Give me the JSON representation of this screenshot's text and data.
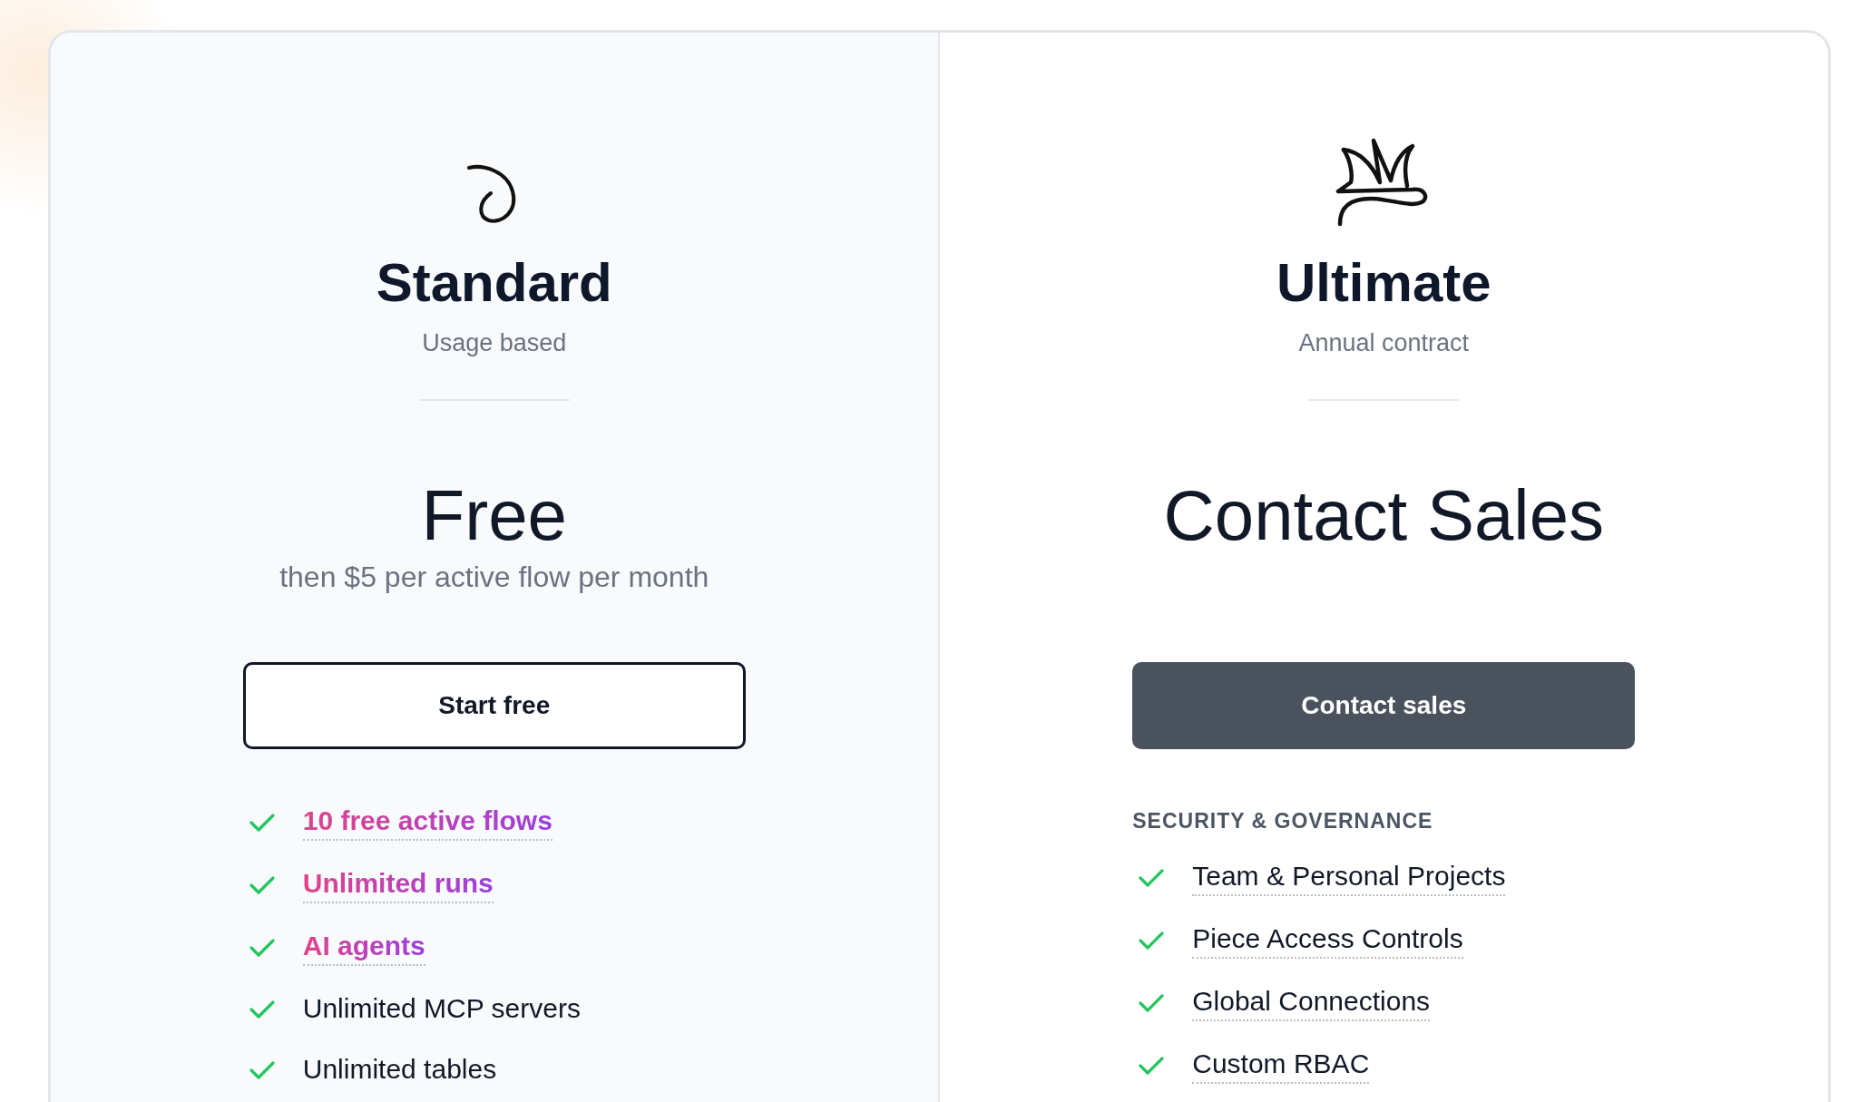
{
  "plans": [
    {
      "name": "Standard",
      "billing": "Usage based",
      "price": "Free",
      "price_note": "then $5 per active flow per month",
      "button": {
        "label": "Start free",
        "kind": "outline"
      },
      "features": [
        {
          "text": "10 free active flows",
          "highlighted": true,
          "underlined": true
        },
        {
          "text": "Unlimited runs",
          "highlighted": true,
          "underlined": true
        },
        {
          "text": "AI agents",
          "highlighted": true,
          "underlined": true
        },
        {
          "text": "Unlimited MCP servers",
          "highlighted": false,
          "underlined": false
        },
        {
          "text": "Unlimited tables",
          "highlighted": false,
          "underlined": false
        }
      ]
    },
    {
      "name": "Ultimate",
      "billing": "Annual contract",
      "price": "Contact Sales",
      "button": {
        "label": "Contact sales",
        "kind": "filled"
      },
      "features_heading": "SECURITY & GOVERNANCE",
      "features": [
        {
          "text": "Team & Personal Projects",
          "highlighted": false,
          "underlined": true
        },
        {
          "text": "Piece Access Controls",
          "highlighted": false,
          "underlined": true
        },
        {
          "text": "Global Connections",
          "highlighted": false,
          "underlined": true
        },
        {
          "text": "Custom RBAC",
          "highlighted": false,
          "underlined": true
        }
      ]
    }
  ]
}
